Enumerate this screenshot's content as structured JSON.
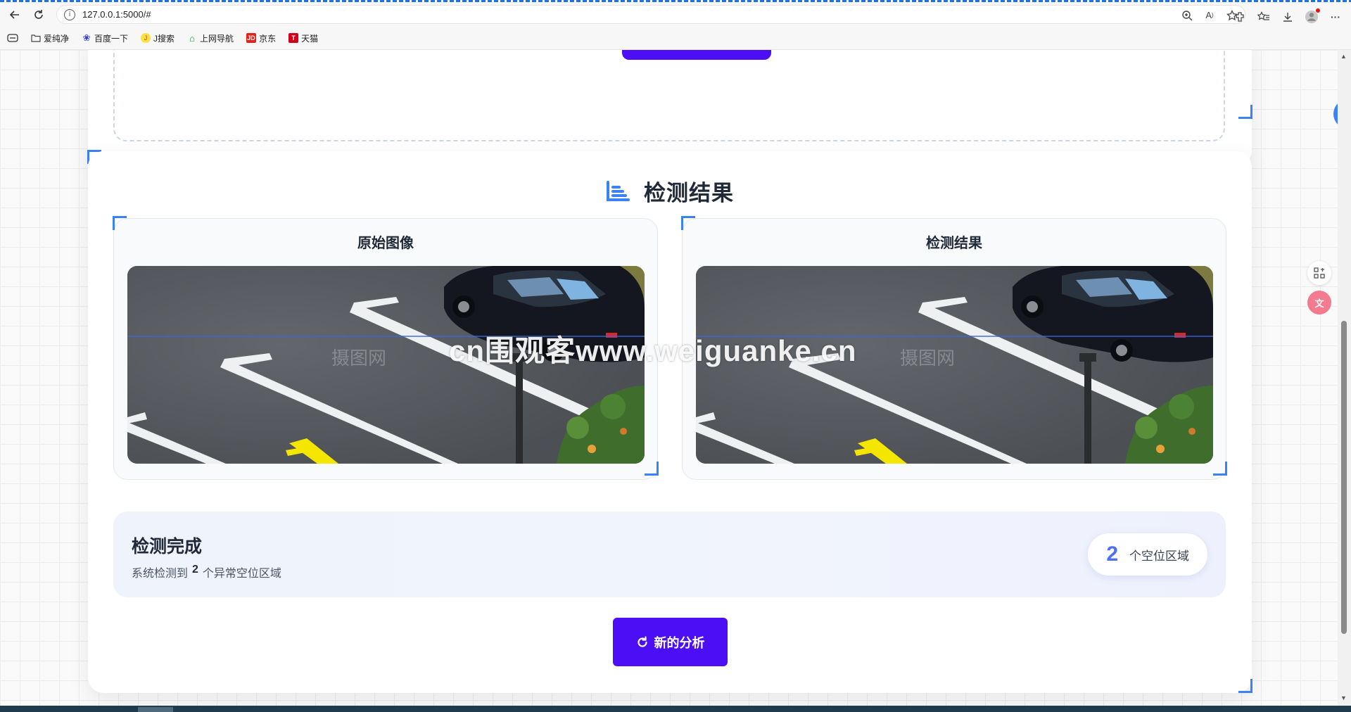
{
  "browser": {
    "url": "127.0.0.1:5000/#",
    "bookmarks": [
      {
        "label": "爱纯净",
        "icon": "folder-icon"
      },
      {
        "label": "百度一下",
        "icon": "baidu-paw-icon"
      },
      {
        "label": "J搜索",
        "icon": "jsearch-icon"
      },
      {
        "label": "上网导航",
        "icon": "nav-icon"
      },
      {
        "label": "京东",
        "icon": "jd-icon"
      },
      {
        "label": "天猫",
        "icon": "tmall-icon"
      }
    ],
    "menu_label": "···"
  },
  "results": {
    "section_title": "检测结果",
    "original_title": "原始图像",
    "result_title": "检测结果"
  },
  "summary": {
    "title": "检测完成",
    "desc_prefix": "系统检测到",
    "count": "2",
    "desc_suffix": "个异常空位区域",
    "pill_count": "2",
    "pill_label": "个空位区域"
  },
  "actions": {
    "new_analysis": "新的分析"
  },
  "watermark": "cn围观客www.weiguanke.cn",
  "colors": {
    "accent": "#4c0ef5",
    "corner": "#3b82f6",
    "count": "#4f6ef7"
  }
}
